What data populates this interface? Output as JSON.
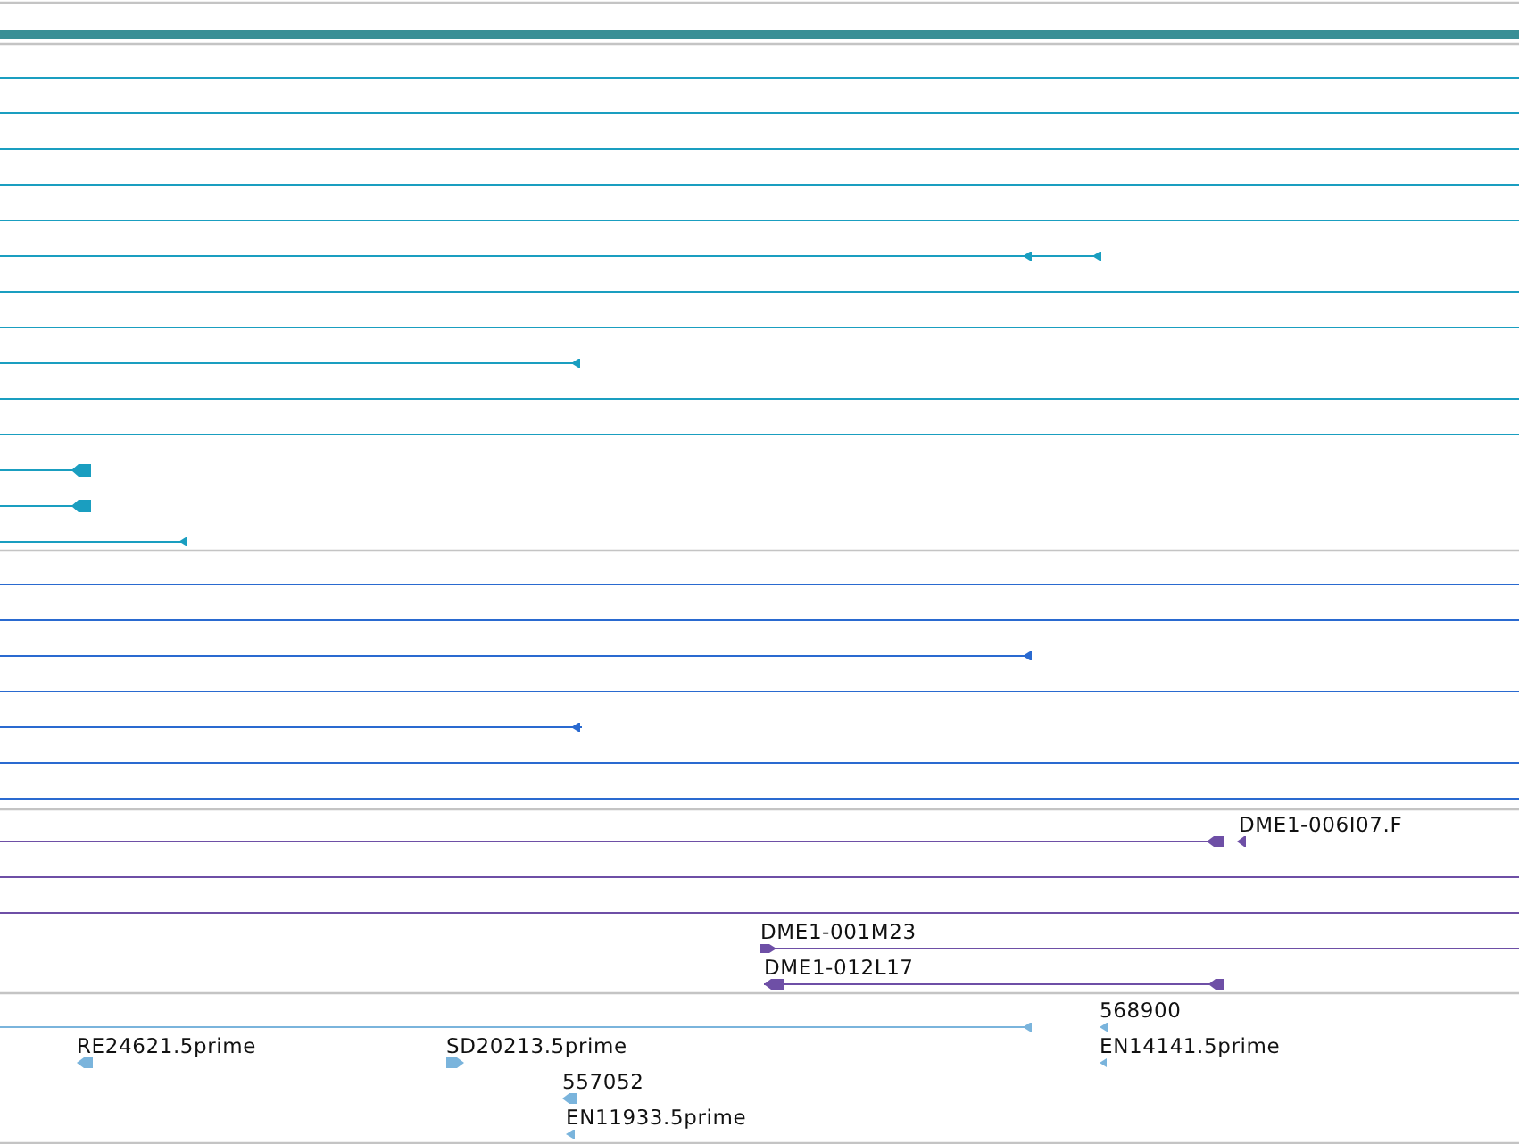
{
  "tracks": [
    {
      "color": "#1a9ec0",
      "rows": [
        {
          "kind": "rule"
        },
        {
          "kind": "rule"
        },
        {
          "kind": "rule"
        },
        {
          "kind": "rule"
        },
        {
          "kind": "rule"
        },
        {
          "kind": "feature"
        },
        {
          "kind": "rule"
        },
        {
          "kind": "rule"
        },
        {
          "kind": "feature"
        },
        {
          "kind": "rule"
        },
        {
          "kind": "rule"
        },
        {
          "kind": "feature"
        },
        {
          "kind": "feature"
        },
        {
          "kind": "feature"
        }
      ]
    },
    {
      "color": "#2a6ad0",
      "rows": [
        {
          "kind": "rule"
        },
        {
          "kind": "rule"
        },
        {
          "kind": "feature"
        },
        {
          "kind": "rule"
        },
        {
          "kind": "feature"
        },
        {
          "kind": "rule"
        },
        {
          "kind": "rule"
        }
      ]
    },
    {
      "color": "#6e4fa6",
      "rows": [
        {
          "kind": "feature",
          "label": "DME1-006I07.F"
        },
        {
          "kind": "rule"
        },
        {
          "kind": "rule"
        },
        {
          "kind": "feature",
          "label": "DME1-001M23"
        },
        {
          "kind": "feature",
          "label": "DME1-012L17"
        }
      ]
    },
    {
      "color": "#7ab4dc",
      "rows": [
        {
          "kind": "feature"
        },
        {
          "kind": "feature",
          "label": "568900"
        },
        {
          "kind": "feature",
          "label": "RE24621.5prime"
        },
        {
          "kind": "feature",
          "label": "SD20213.5prime"
        },
        {
          "kind": "feature",
          "label": "EN14141.5prime"
        },
        {
          "kind": "feature",
          "label": "557052"
        },
        {
          "kind": "feature",
          "label": "EN11933.5prime"
        }
      ]
    }
  ]
}
